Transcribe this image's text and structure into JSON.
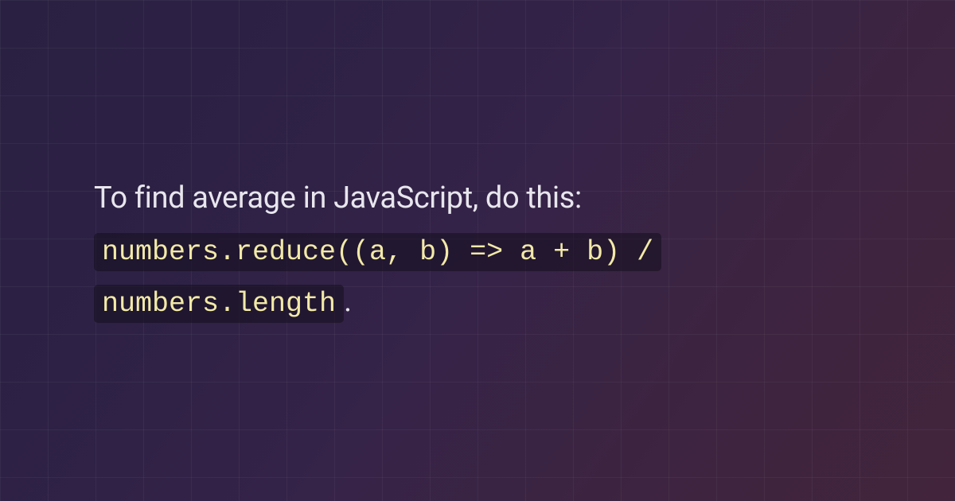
{
  "content": {
    "intro_text": "To find average in JavaScript, do this:",
    "code_part_1": "numbers.reduce((a, b) => a + b) /",
    "code_part_2": "numbers.length",
    "period": "."
  },
  "colors": {
    "background_start": "#2a2142",
    "background_end": "#42253c",
    "text": "#e8e6ed",
    "code_text": "#f2e9a8",
    "code_bg": "rgba(20, 15, 30, 0.55)",
    "grid": "rgba(255, 255, 255, 0.045)"
  }
}
